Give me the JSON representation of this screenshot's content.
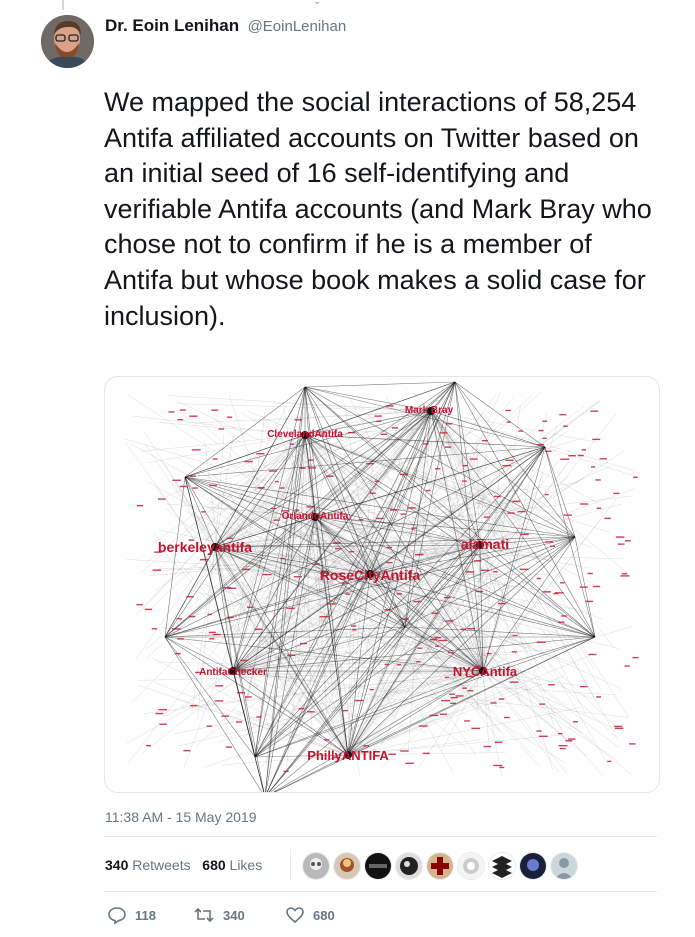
{
  "tweet": {
    "display_name": "Dr. Eoin Lenihan",
    "handle": "@EoinLenihan",
    "text": "We mapped the social interactions of 58,254 Antifa affiliated accounts on Twitter based on an initial seed of 16 self-identifying and verifiable Antifa accounts (and Mark Bray who chose not to confirm if he is a member of Antifa but whose book makes a solid case for inclusion).",
    "timestamp": "11:38 AM - 15 May 2019"
  },
  "media": {
    "node_labels": {
      "mark_bray": "Mark Bray",
      "cleveland": "ClevelandAntifa",
      "orlando": "OrlandoAntifa",
      "berkeley": "berkeleyantifa",
      "alamati": "alamati",
      "rosecity": "RoseCityAntifa",
      "antifachecker": "AntifaChecker",
      "nycantifa": "NYCAntifa",
      "philly": "PhillyANTIFA"
    },
    "colors": {
      "node_label": "#c4122f",
      "edge": "#333333"
    }
  },
  "stats": {
    "retweets_count": "340",
    "retweets_label": "Retweets",
    "likes_count": "680",
    "likes_label": "Likes"
  },
  "actions": {
    "reply_count": "118",
    "retweet_count": "340",
    "like_count": "680"
  },
  "colors": {
    "text": "#14171a",
    "secondary": "#657786",
    "divider": "#e6ecf0"
  }
}
